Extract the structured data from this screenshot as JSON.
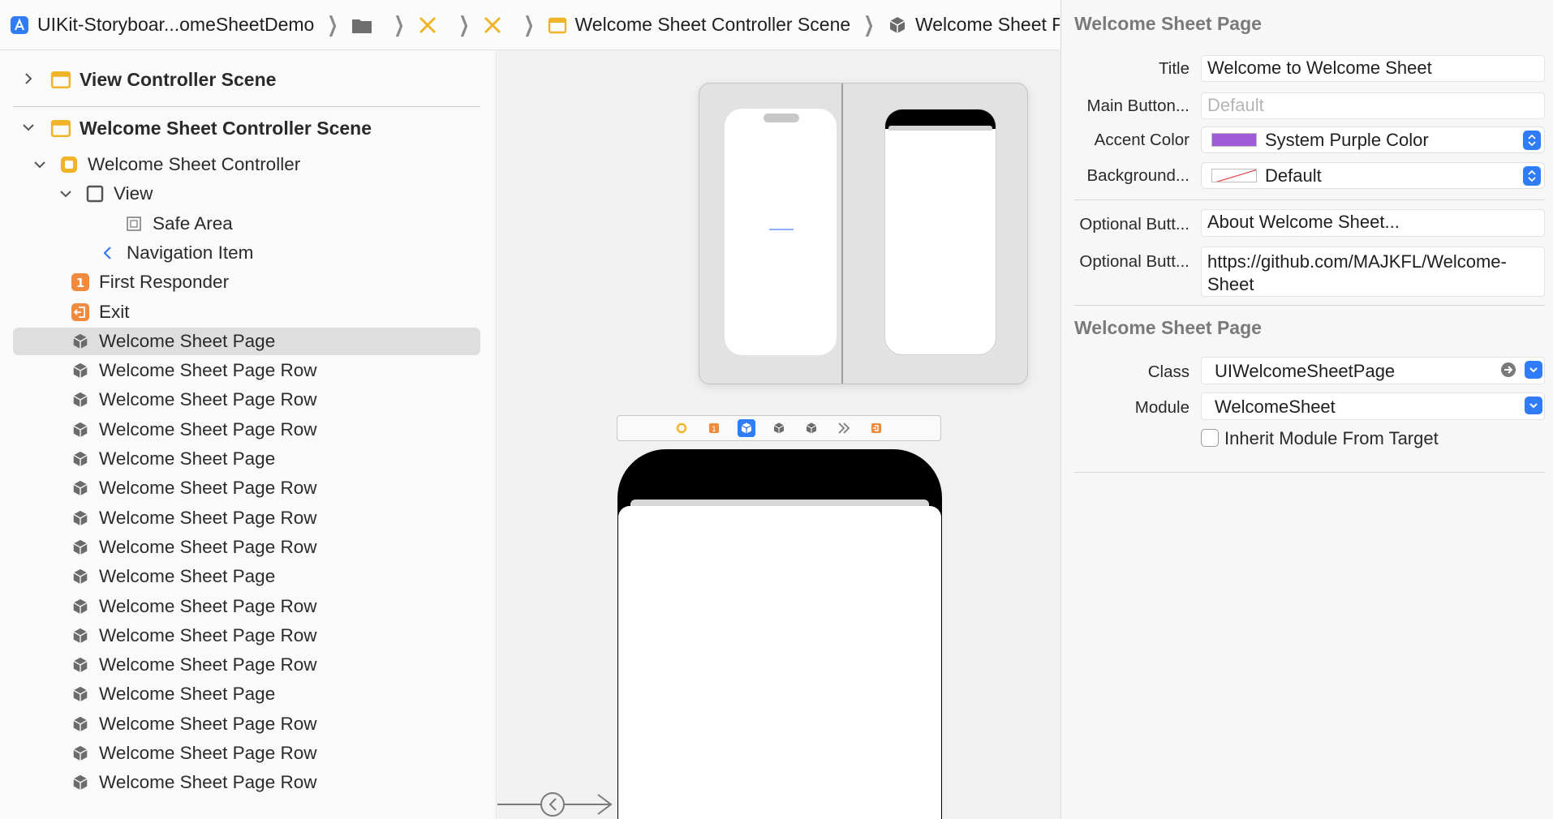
{
  "breadcrumb": {
    "project": "UIKit-Storyboar...omeSheetDemo",
    "scene": "Welcome Sheet Controller Scene",
    "current": "Welcome Sheet Page",
    "icons": [
      "app-icon",
      "folder-icon",
      "storyboard-icon",
      "storyboard-icon",
      "scene-icon",
      "object-cube-icon"
    ]
  },
  "outline": {
    "scene1": "View Controller Scene",
    "scene2": "Welcome Sheet Controller Scene",
    "items": [
      {
        "label": "Welcome Sheet Controller",
        "icon": "view-controller-icon"
      },
      {
        "label": "View",
        "icon": "view-icon"
      },
      {
        "label": "Safe Area",
        "icon": "safe-area-icon"
      },
      {
        "label": "Navigation Item",
        "icon": "navigation-item-icon"
      },
      {
        "label": "First Responder",
        "icon": "first-responder-icon"
      },
      {
        "label": "Exit",
        "icon": "exit-icon"
      },
      {
        "label": "Welcome Sheet Page",
        "icon": "object-cube-icon",
        "selected": true
      },
      {
        "label": "Welcome Sheet Page Row",
        "icon": "object-cube-icon"
      },
      {
        "label": "Welcome Sheet Page Row",
        "icon": "object-cube-icon"
      },
      {
        "label": "Welcome Sheet Page Row",
        "icon": "object-cube-icon"
      },
      {
        "label": "Welcome Sheet Page",
        "icon": "object-cube-icon"
      },
      {
        "label": "Welcome Sheet Page Row",
        "icon": "object-cube-icon"
      },
      {
        "label": "Welcome Sheet Page Row",
        "icon": "object-cube-icon"
      },
      {
        "label": "Welcome Sheet Page Row",
        "icon": "object-cube-icon"
      },
      {
        "label": "Welcome Sheet Page",
        "icon": "object-cube-icon"
      },
      {
        "label": "Welcome Sheet Page Row",
        "icon": "object-cube-icon"
      },
      {
        "label": "Welcome Sheet Page Row",
        "icon": "object-cube-icon"
      },
      {
        "label": "Welcome Sheet Page Row",
        "icon": "object-cube-icon"
      },
      {
        "label": "Welcome Sheet Page",
        "icon": "object-cube-icon"
      },
      {
        "label": "Welcome Sheet Page Row",
        "icon": "object-cube-icon"
      },
      {
        "label": "Welcome Sheet Page Row",
        "icon": "object-cube-icon"
      },
      {
        "label": "Welcome Sheet Page Row",
        "icon": "object-cube-icon"
      }
    ]
  },
  "inspector": {
    "section1_title": "Welcome Sheet Page",
    "title_label": "Title",
    "title_value": "Welcome to Welcome Sheet",
    "main_button_label": "Main Button...",
    "main_button_placeholder": "Default",
    "accent_label": "Accent Color",
    "accent_value": "System Purple Color",
    "accent_color": "#a05bd6",
    "background_label": "Background...",
    "background_value": "Default",
    "optional1_label": "Optional Butt...",
    "optional1_value": "About Welcome Sheet...",
    "optional2_label": "Optional Butt...",
    "optional2_value": "https://github.com/MAJKFL/Welcome-Sheet",
    "section2_title": "Welcome Sheet Page",
    "class_label": "Class",
    "class_value": "UIWelcomeSheetPage",
    "module_label": "Module",
    "module_value": "WelcomeSheet",
    "inherit_label": "Inherit Module From Target"
  },
  "colors": {
    "accent_blue": "#2f7cf6",
    "scene_yellow": "#f0b429",
    "responder_orange": "#f08a3c"
  }
}
